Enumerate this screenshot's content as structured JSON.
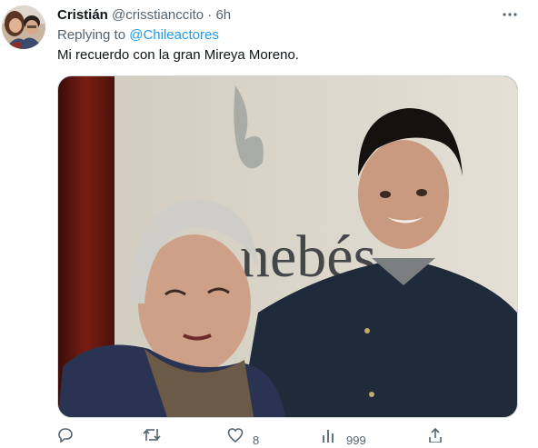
{
  "tweet": {
    "author_name": "Cristián",
    "author_handle": "@crisstianccito",
    "separator": "·",
    "time": "6h",
    "replying_to_prefix": "Replying to",
    "replying_to_handle": "@Chileactores",
    "text": "Mi recuerdo con la gran Mireya Moreno.",
    "media_background_text": "nebés"
  },
  "actions": {
    "reply_count": "",
    "retweet_count": "",
    "like_count": "8",
    "views_count": "999"
  },
  "icons": {
    "more": "more-horizontal-icon",
    "reply": "reply-icon",
    "retweet": "retweet-icon",
    "like": "heart-icon",
    "views": "analytics-icon",
    "share": "share-icon"
  },
  "colors": {
    "link": "#1d9bf0",
    "secondary_text": "#536471",
    "primary_text": "#0f1419"
  }
}
